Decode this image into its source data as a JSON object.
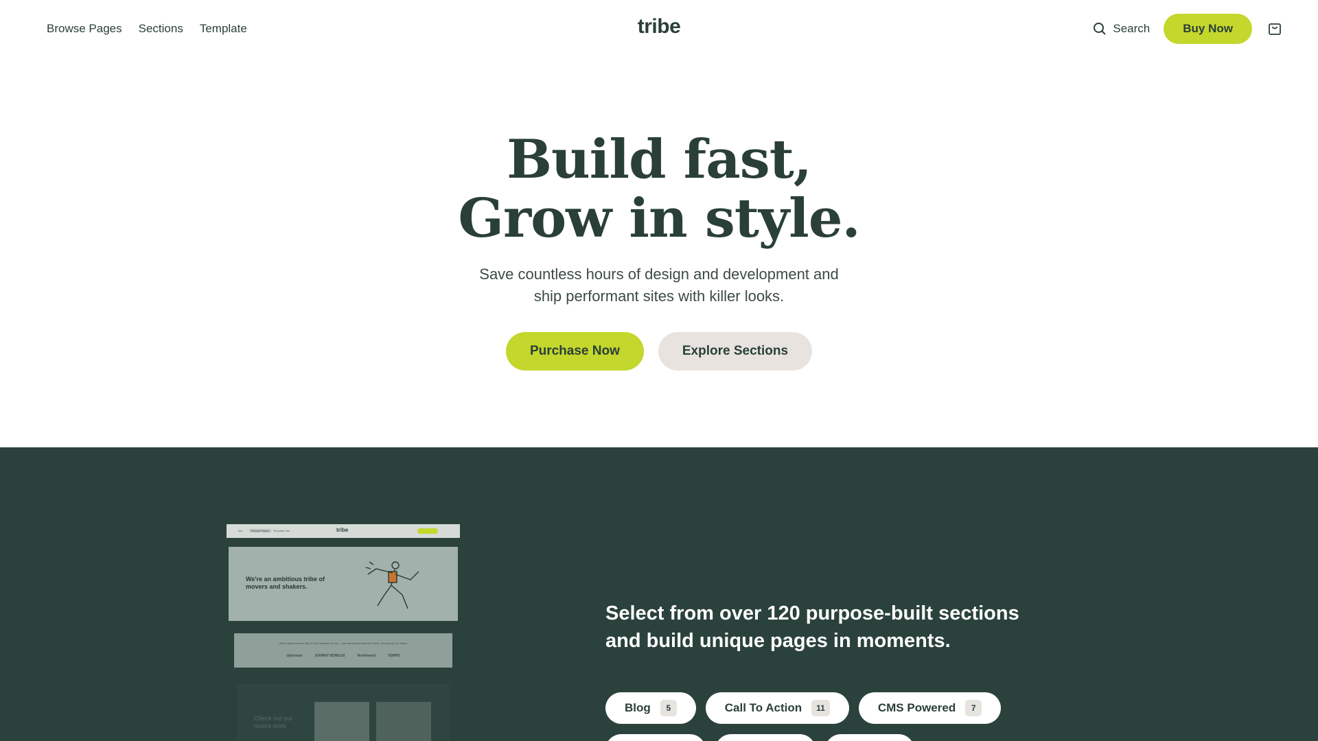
{
  "nav": {
    "links": [
      "Browse Pages",
      "Sections",
      "Template"
    ],
    "logo": "tribe",
    "search_label": "Search",
    "buy_label": "Buy Now"
  },
  "hero": {
    "title_line1": "Build fast,",
    "title_line2": "Grow in style.",
    "sub_line1": "Save countless hours of design and development and",
    "sub_line2": "ship performant sites with killer looks.",
    "primary_cta": "Purchase Now",
    "secondary_cta": "Explore Sections"
  },
  "preview": {
    "nav_links": [
      "Tour",
      "Browse Pages",
      "Template Info"
    ],
    "logo": "tribe",
    "hero_text_line1": "We're an ambitious tribe of",
    "hero_text_line2": "movers and shakers.",
    "strip_text": "We've helped teams ship 30,000 websites so far — join amazing brands like these, who speak our dialect",
    "logos": [
      "Upstream",
      "JOHNNY BOWLES",
      "Northwood",
      "TEMPO"
    ],
    "bottom_text_line1": "Check out our",
    "bottom_text_line2": "recent work"
  },
  "section": {
    "headline_line1": "Select from over 120 purpose-built sections",
    "headline_line2": "and build unique pages in moments.",
    "tags": [
      {
        "label": "Blog",
        "count": "5"
      },
      {
        "label": "Call To Action",
        "count": "11"
      },
      {
        "label": "CMS Powered",
        "count": "7"
      }
    ]
  },
  "colors": {
    "accent": "#c4d72c",
    "dark_bg": "#2b423c",
    "text": "#2a3f39",
    "secondary_btn": "#e8e3de"
  }
}
